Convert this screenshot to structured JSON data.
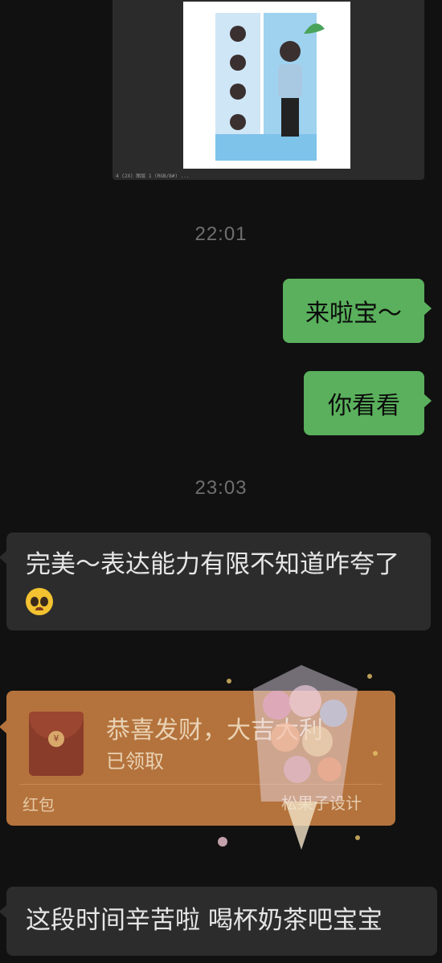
{
  "image_message": {
    "caption": "4 (2X) 图层 1 (RGB/8#) ..."
  },
  "timestamps": [
    "22:01",
    "23:03"
  ],
  "outgoing": [
    {
      "text": "来啦宝～"
    },
    {
      "text": "你看看"
    }
  ],
  "incoming_1": {
    "text": "完美～表达能力有限不知道咋夸了"
  },
  "red_packet": {
    "title": "恭喜发财，大吉大利",
    "status": "已领取",
    "footer": "红包",
    "watermark": "松果子设计",
    "envelope_symbol": "¥"
  },
  "incoming_2": {
    "text": "这段时间辛苦啦 喝杯奶茶吧宝宝"
  },
  "colors": {
    "bg": "#111111",
    "outgoing": "#5ab05c",
    "incoming": "#2c2c2c",
    "red_packet": "#b4733c"
  }
}
